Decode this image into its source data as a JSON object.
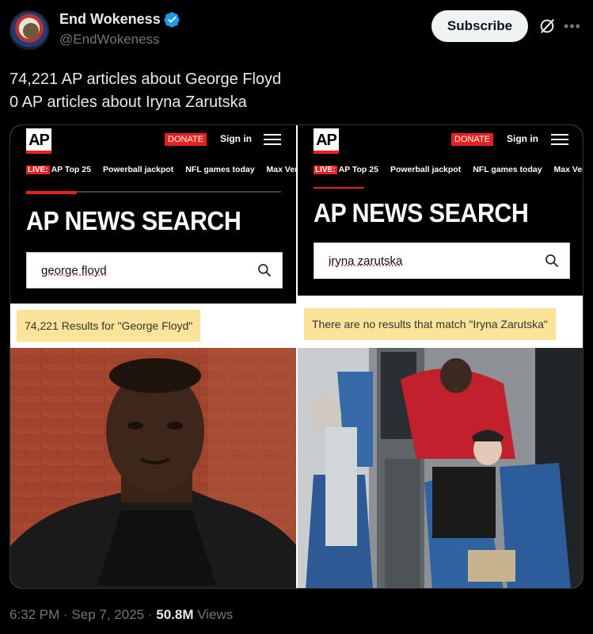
{
  "author": {
    "display_name": "End Wokeness",
    "handle": "@EndWokeness",
    "avatar": "avatar-icon"
  },
  "header": {
    "subscribe_label": "Subscribe",
    "grok_icon": "grok-icon",
    "more_icon": "more-icon"
  },
  "tweet": {
    "line1": "74,221 AP articles about George Floyd",
    "line2": "0 AP articles about Iryna Zarutska"
  },
  "media": {
    "left": {
      "logo": "AP",
      "donate": "DONATE",
      "signin": "Sign in",
      "nav": {
        "live": "LIVE:",
        "items": [
          "AP Top 25",
          "Powerball jackpot",
          "NFL games today",
          "Max Ver"
        ]
      },
      "title": "AP NEWS SEARCH",
      "query": "george floyd",
      "result": "74,221 Results for \"George Floyd\""
    },
    "right": {
      "logo": "AP",
      "donate": "DONATE",
      "signin": "Sign in",
      "nav": {
        "live": "LIVE:",
        "items": [
          "AP Top 25",
          "Powerball jackpot",
          "NFL games today",
          "Max Ver"
        ]
      },
      "title": "AP NEWS SEARCH",
      "query": "iryna zarutska",
      "result": "There are no results that match \"Iryna Zarutska\""
    }
  },
  "footer": {
    "time": "6:32 PM",
    "sep1": " · ",
    "date": "Sep 7, 2025",
    "sep2": " · ",
    "views": "50.8M",
    "views_label": " Views"
  },
  "colors": {
    "background": "#000000",
    "ap_red": "#e8201f",
    "result_highlight": "#fbe49a",
    "verified_blue": "#1d9bf0"
  }
}
